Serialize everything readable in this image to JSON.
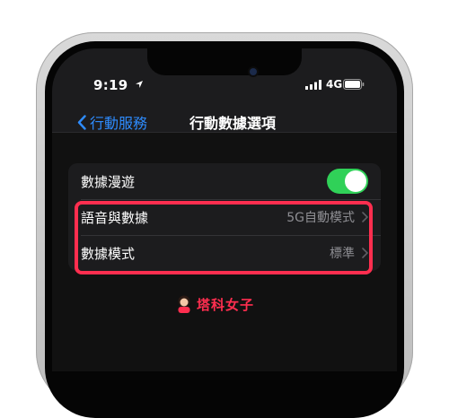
{
  "status_bar": {
    "time": "9:19",
    "network": "4G"
  },
  "nav": {
    "back_label": "行動服務",
    "title": "行動數據選項"
  },
  "settings": [
    {
      "label": "數據漫遊",
      "control": "toggle",
      "on": true
    },
    {
      "label": "語音與數據",
      "value": "5G自動模式"
    },
    {
      "label": "數據模式",
      "value": "標準"
    }
  ],
  "watermark": {
    "text": "塔科女子"
  },
  "colors": {
    "accent_blue": "#2e8cff",
    "toggle_green": "#30d158",
    "highlight_red": "#ff2e4f"
  },
  "icons": [
    "location-icon",
    "signal-icon",
    "battery-icon",
    "chevron-left-icon",
    "chevron-right-icon"
  ]
}
